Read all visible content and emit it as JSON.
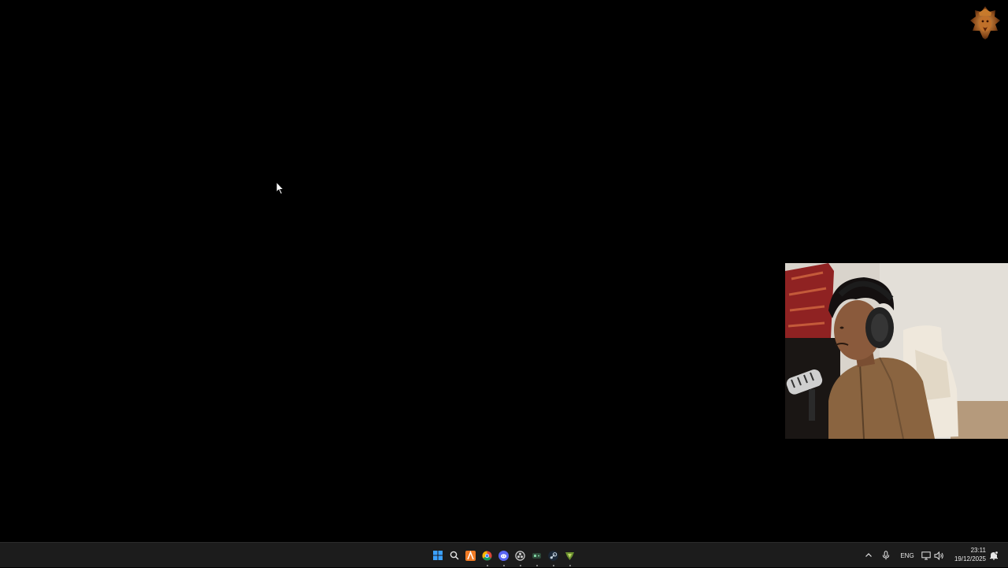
{
  "taskbar": {
    "start_icon": "windows-start-icon",
    "pinned": [
      {
        "name": "search",
        "icon": "search-icon",
        "running": false
      },
      {
        "name": "app-orange",
        "icon": "orange-app-icon",
        "running": false
      },
      {
        "name": "chrome",
        "icon": "chrome-icon",
        "running": true
      },
      {
        "name": "discord",
        "icon": "discord-icon",
        "running": true
      },
      {
        "name": "obs",
        "icon": "obs-icon",
        "running": true
      },
      {
        "name": "game-app",
        "icon": "game-app-icon",
        "running": true
      },
      {
        "name": "steam",
        "icon": "steam-icon",
        "running": true
      },
      {
        "name": "green-app",
        "icon": "green-app-icon",
        "running": true
      }
    ],
    "tray": {
      "language": "ENG",
      "time": "23:11",
      "date": "19/12/2025"
    }
  },
  "colors": {
    "desktop": "#000000",
    "taskbar": "#1c1c1c",
    "windows_blue": "#3aa0ff"
  }
}
